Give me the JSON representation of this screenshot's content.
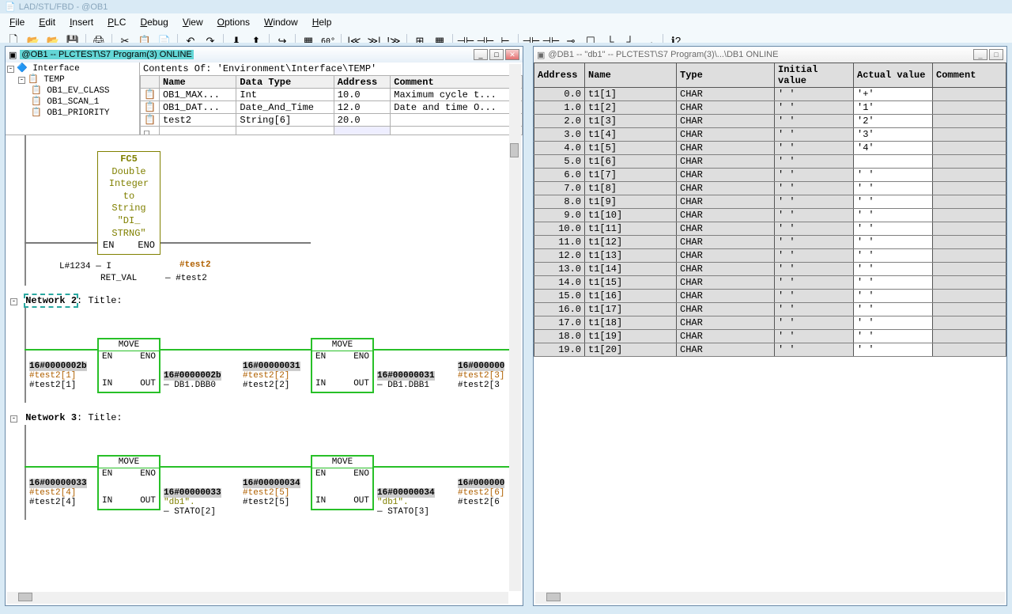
{
  "app_title": "LAD/STL/FBD - @OB1",
  "menu": [
    "File",
    "Edit",
    "Insert",
    "PLC",
    "Debug",
    "View",
    "Options",
    "Window",
    "Help"
  ],
  "left_window": {
    "title": "@OB1 -- PLCTEST\\S7 Program(3)  ONLINE",
    "contents_label": "Contents Of: 'Environment\\Interface\\TEMP'",
    "tree": [
      "Interface",
      "TEMP",
      "OB1_EV_CLASS",
      "OB1_SCAN_1",
      "OB1_PRIORITY"
    ],
    "var_headers": [
      "Name",
      "Data Type",
      "Address",
      "Comment"
    ],
    "vars": [
      {
        "name": "OB1_MAX...",
        "type": "Int",
        "addr": "10.0",
        "comment": "Maximum cycle t..."
      },
      {
        "name": "OB1_DAT...",
        "type": "Date_And_Time",
        "addr": "12.0",
        "comment": "Date and time O..."
      },
      {
        "name": "test2",
        "type": "String[6]",
        "addr": "20.0",
        "comment": ""
      }
    ],
    "fc_block": {
      "name": "FC5",
      "desc": "Double\nInteger\nto\nString",
      "sig": "\"DI_\nSTRNG\"",
      "en": "EN",
      "eno": "ENO",
      "ret": "RET_VAL",
      "in": "I",
      "in_lbl": "L#1234",
      "out_comment": "#test2",
      "out_sym": "#test2"
    },
    "net2": "Network 2",
    "net3": "Network 3",
    "title_suffix": ": Title:",
    "move_block": "MOVE",
    "en": "EN",
    "eno": "ENO",
    "in": "IN",
    "out": "OUT",
    "n2": {
      "in1_top": "16#0000002b",
      "in1_mid": "#test2[1]",
      "in1_bot": "#test2[1]",
      "out1_top": "16#0000002b",
      "out1_bot": "DB1.DBB0",
      "in2_top": "16#00000031",
      "in2_mid": "#test2[2]",
      "in2_bot": "#test2[2]",
      "out2_top": "16#00000031",
      "out2_bot": "DB1.DBB1",
      "in3_top": "16#000000",
      "in3_mid": "#test2[3]",
      "in3_bot": "#test2[3"
    },
    "n3": {
      "in1_top": "16#00000033",
      "in1_mid": "#test2[4]",
      "in1_bot": "#test2[4]",
      "out1_top": "16#00000033",
      "out1_bot": "STATO[2]",
      "in2_top": "16#00000034",
      "in2_mid": "#test2[5]",
      "in2_bot": "#test2[5]",
      "out2_top": "16#00000034",
      "out2_bot": "STATO[3]",
      "out1_mid": "\"db1\".",
      "in3_top": "16#000000",
      "in3_mid": "#test2[6]",
      "in3_bot": "#test2[6"
    }
  },
  "right_window": {
    "title": "@DB1 -- \"db1\" -- PLCTEST\\S7 Program(3)\\...\\DB1  ONLINE",
    "headers": [
      "Address",
      "Name",
      "Type",
      "Initial value",
      "Actual value",
      "Comment"
    ],
    "rows": [
      {
        "addr": "0.0",
        "name": "t1[1]",
        "type": "CHAR",
        "init": "' '",
        "actual": "'+'"
      },
      {
        "addr": "1.0",
        "name": "t1[2]",
        "type": "CHAR",
        "init": "' '",
        "actual": "'1'"
      },
      {
        "addr": "2.0",
        "name": "t1[3]",
        "type": "CHAR",
        "init": "' '",
        "actual": "'2'"
      },
      {
        "addr": "3.0",
        "name": "t1[4]",
        "type": "CHAR",
        "init": "' '",
        "actual": "'3'"
      },
      {
        "addr": "4.0",
        "name": "t1[5]",
        "type": "CHAR",
        "init": "' '",
        "actual": "'4'"
      },
      {
        "addr": "5.0",
        "name": "t1[6]",
        "type": "CHAR",
        "init": "' '",
        "actual": ""
      },
      {
        "addr": "6.0",
        "name": "t1[7]",
        "type": "CHAR",
        "init": "' '",
        "actual": "' '"
      },
      {
        "addr": "7.0",
        "name": "t1[8]",
        "type": "CHAR",
        "init": "' '",
        "actual": "' '"
      },
      {
        "addr": "8.0",
        "name": "t1[9]",
        "type": "CHAR",
        "init": "' '",
        "actual": "' '"
      },
      {
        "addr": "9.0",
        "name": "t1[10]",
        "type": "CHAR",
        "init": "' '",
        "actual": "' '"
      },
      {
        "addr": "10.0",
        "name": "t1[11]",
        "type": "CHAR",
        "init": "' '",
        "actual": "' '"
      },
      {
        "addr": "11.0",
        "name": "t1[12]",
        "type": "CHAR",
        "init": "' '",
        "actual": "' '"
      },
      {
        "addr": "12.0",
        "name": "t1[13]",
        "type": "CHAR",
        "init": "' '",
        "actual": "' '"
      },
      {
        "addr": "13.0",
        "name": "t1[14]",
        "type": "CHAR",
        "init": "' '",
        "actual": "' '"
      },
      {
        "addr": "14.0",
        "name": "t1[15]",
        "type": "CHAR",
        "init": "' '",
        "actual": "' '"
      },
      {
        "addr": "15.0",
        "name": "t1[16]",
        "type": "CHAR",
        "init": "' '",
        "actual": "' '"
      },
      {
        "addr": "16.0",
        "name": "t1[17]",
        "type": "CHAR",
        "init": "' '",
        "actual": "' '"
      },
      {
        "addr": "17.0",
        "name": "t1[18]",
        "type": "CHAR",
        "init": "' '",
        "actual": "' '"
      },
      {
        "addr": "18.0",
        "name": "t1[19]",
        "type": "CHAR",
        "init": "' '",
        "actual": "' '"
      },
      {
        "addr": "19.0",
        "name": "t1[20]",
        "type": "CHAR",
        "init": "' '",
        "actual": "' '"
      }
    ]
  }
}
